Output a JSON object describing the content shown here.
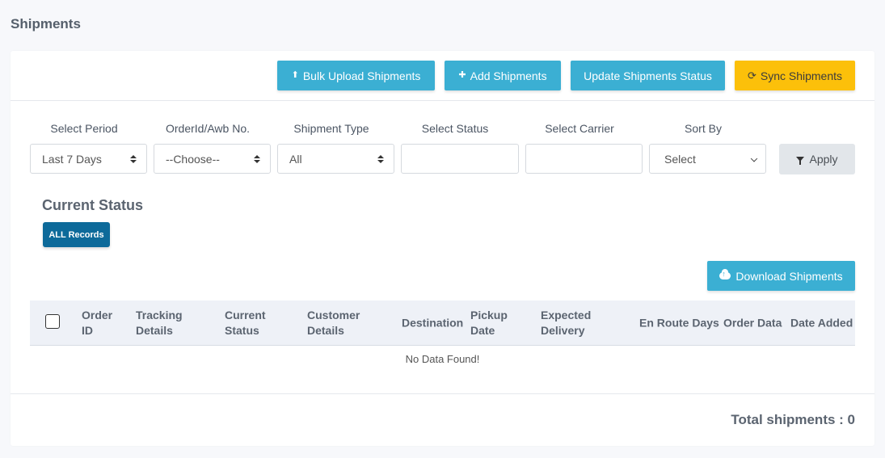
{
  "page": {
    "title": "Shipments"
  },
  "toolbar": {
    "bulk_upload": {
      "label": "Bulk Upload Shipments",
      "icon": "upload-icon"
    },
    "add": {
      "label": "Add Shipments",
      "icon": "plus-icon"
    },
    "update_status": {
      "label": "Update Shipments Status"
    },
    "sync": {
      "label": "Sync Shipments",
      "icon": "sync-icon"
    }
  },
  "filters": {
    "period": {
      "label": "Select Period",
      "value": "Last 7 Days"
    },
    "order": {
      "label": "OrderId/Awb No.",
      "value": "--Choose--"
    },
    "type": {
      "label": "Shipment Type",
      "value": "All"
    },
    "status": {
      "label": "Select Status",
      "value": ""
    },
    "carrier": {
      "label": "Select Carrier",
      "value": ""
    },
    "sort": {
      "label": "Sort By",
      "value": "Select"
    },
    "apply_label": "Apply"
  },
  "current_status": {
    "title": "Current Status",
    "all_records_label": "ALL Records"
  },
  "download": {
    "label": "Download Shipments"
  },
  "table": {
    "headers": [
      [
        "Order",
        "ID"
      ],
      [
        "Tracking",
        "Details"
      ],
      [
        "Current",
        "Status"
      ],
      [
        "Customer",
        "Details"
      ],
      [
        "Destination"
      ],
      [
        "Pickup",
        "Date"
      ],
      [
        "Expected",
        "Delivery"
      ],
      [
        "En Route Days"
      ],
      [
        "Order Data"
      ],
      [
        "Date Added"
      ]
    ],
    "empty_text": "No Data Found!"
  },
  "footer": {
    "total_label": "Total shipments : 0"
  },
  "colors": {
    "info": "#3bafd3",
    "warning": "#fcc00a",
    "primary_dark": "#0d6a9a"
  }
}
